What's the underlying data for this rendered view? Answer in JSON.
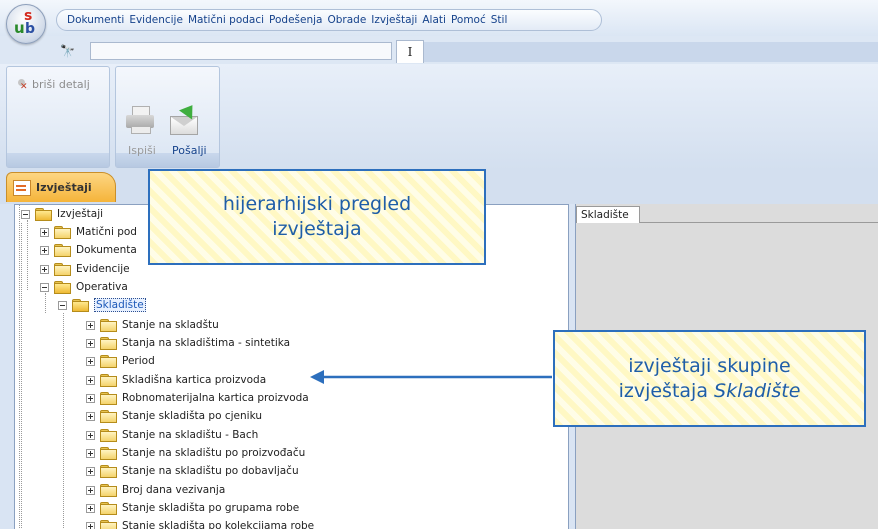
{
  "menu": {
    "items": [
      "Dokumenti",
      "Evidencije",
      "Matični podaci",
      "Podešenja",
      "Obrade",
      "Izvještaji",
      "Alati",
      "Pomoć",
      "Stil"
    ]
  },
  "logo": {
    "u": "u",
    "b": "b",
    "s": "s"
  },
  "quickbar": {
    "search_value": "",
    "tab_label": "I"
  },
  "ribbon": {
    "delete_detail_label": "briši detalj",
    "print_label": "Ispiši",
    "send_label": "Pošalji"
  },
  "doc_tab": {
    "label": "Izvještaji"
  },
  "right_panel": {
    "tab_label": "Skladište"
  },
  "tree": {
    "root": "Izvještaji",
    "level1": [
      "Matični pod",
      "Dokumenta",
      "Evidencije",
      "Operativa"
    ],
    "selected": "Skladište",
    "reports": [
      "Stanje na skladštu",
      "Stanja na skladištima - sintetika",
      "Period",
      "Skladišna kartica proizvoda",
      "Robnomaterijalna kartica proizvoda",
      "Stanje skladišta po cjeniku",
      "Stanje na skladištu - Bach",
      "Stanje na skladištu po proizvođaču",
      "Stanje na skladištu po dobavljaču",
      "Broj dana vezivanja",
      "Stanje skladišta po grupama robe",
      "Stanje skladišta po kolekcijama robe"
    ]
  },
  "callouts": {
    "hierarchy_line1": "hijerarhijski pregled",
    "hierarchy_line2": "izvještaja",
    "group_line1": "izvještaji skupine",
    "group_line2_prefix": "izvještaja ",
    "group_line2_italic": "Skladište"
  },
  "colors": {
    "accent": "#2d6fbd",
    "tab_orange": "#f5b43a",
    "selection": "#1d59b8"
  }
}
